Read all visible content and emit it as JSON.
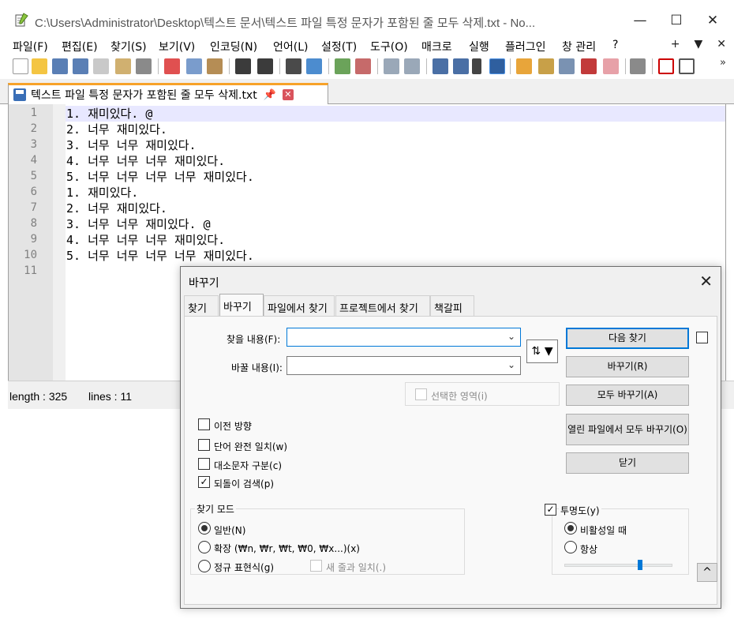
{
  "window": {
    "title": "C:\\Users\\Administrator\\Desktop\\텍스트 문서\\텍스트 파일 특정 문자가 포함된 줄 모두 삭제.txt - No...",
    "minimize": "—",
    "maximize": "☐",
    "close": "✕"
  },
  "menu": {
    "items": [
      "파일(F)",
      "편집(E)",
      "찾기(S)",
      "보기(V)",
      "인코딩(N)",
      "언어(L)",
      "설정(T)",
      "도구(O)",
      "매크로",
      "실행",
      "플러그인",
      "창 관리",
      "?"
    ],
    "right": [
      "+",
      "▼",
      "✕"
    ]
  },
  "toolbar": {
    "more": "»"
  },
  "tab": {
    "label": "텍스트 파일 특정 문자가 포함된 줄 모두 삭제.txt",
    "pin": "📌",
    "close": "✕"
  },
  "editor": {
    "line_numbers": [
      "1",
      "2",
      "3",
      "4",
      "5",
      "6",
      "7",
      "8",
      "9",
      "10",
      "11"
    ],
    "lines": [
      "1. 재미있다. @",
      "2. 너무 재미있다.",
      "3. 너무 너무 재미있다.",
      "4. 너무 너무 너무 재미있다.",
      "5. 너무 너무 너무 너무 재미있다.",
      "1. 재미있다.",
      "2. 너무 재미있다.",
      "3. 너무 너무 재미있다. @",
      "4. 너무 너무 너무 재미있다.",
      "5. 너무 너무 너무 너무 재미있다.",
      ""
    ]
  },
  "status": {
    "length": "length : 325",
    "lines": "lines : 11"
  },
  "dialog": {
    "title": "바꾸기",
    "close": "✕",
    "tabs": [
      "찾기",
      "바꾸기",
      "파일에서 찾기",
      "프로젝트에서 찾기",
      "책갈피"
    ],
    "active_tab": "바꾸기",
    "find_label": "찾을 내용(F):",
    "find_value": "",
    "replace_label": "바꿀 내용(I):",
    "replace_value": "",
    "swap_icon": "⇅",
    "swap_arrow": "▼",
    "in_selection": "선택한 영역(i)",
    "buttons": {
      "find_next": "다음 찾기",
      "replace": "바꾸기(R)",
      "replace_all": "모두 바꾸기(A)",
      "replace_all_open": "열린 파일에서 모두 바꾸기(O)",
      "close": "닫기"
    },
    "options": {
      "backward": "이전 방향",
      "whole_word": "단어 완전 일치(w)",
      "match_case": "대소문자 구분(c)",
      "wrap": "되돌이 검색(p)"
    },
    "options_checked": {
      "backward": false,
      "whole_word": false,
      "match_case": false,
      "wrap": true
    },
    "search_mode": {
      "title": "찾기 모드",
      "normal": "일반(N)",
      "extended": "확장 (₩n, ₩r, ₩t, ₩0, ₩x...)(x)",
      "regex": "정규 표현식(g)",
      "dot_newline": "새 줄과 일치(.)",
      "selected": "normal"
    },
    "transparency": {
      "title": "투명도(y)",
      "checked": true,
      "on_lose_focus": "비활성일 때",
      "always": "항상",
      "selected": "on_lose_focus",
      "level": 0.7
    },
    "collapse": "^"
  },
  "colors": {
    "tab_accent": "#f7a229",
    "bookmark_underline": "#e0263a",
    "focus_blue": "#0078d7",
    "current_line": "#e8e8ff"
  }
}
